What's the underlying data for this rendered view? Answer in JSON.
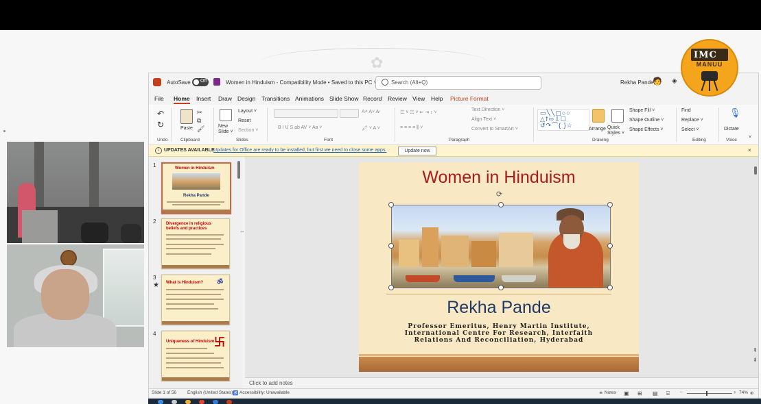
{
  "window": {
    "autosave_label": "AutoSave",
    "autosave_state": "Off",
    "doc_title": "Women in Hinduism  -  Compatibility Mode • Saved to this PC ˅",
    "search_placeholder": "Search (Alt+Q)",
    "user_name": "Rekha Pande"
  },
  "menu": [
    "File",
    "Home",
    "Insert",
    "Draw",
    "Design",
    "Transitions",
    "Animations",
    "Slide Show",
    "Record",
    "Review",
    "View",
    "Help",
    "Picture Format"
  ],
  "ribbon": {
    "undo": "Undo",
    "clipboard": "Clipboard",
    "paste": "Paste",
    "slides": "Slides",
    "new_slide": "New Slide ˅",
    "layout": "Layout ˅",
    "reset": "Reset",
    "section": "Section ˅",
    "font": "Font",
    "paragraph": "Paragraph",
    "text_direction": "Text Direction ˅",
    "align_text": "Align Text ˅",
    "convert_smartart": "Convert to SmartArt ˅",
    "drawing": "Drawing",
    "arrange": "Arrange",
    "quick_styles": "Quick Styles ˅",
    "shape_fill": "Shape Fill ˅",
    "shape_outline": "Shape Outline ˅",
    "shape_effects": "Shape Effects ˅",
    "find": "Find",
    "replace": "Replace ˅",
    "select": "Select ˅",
    "editing": "Editing",
    "dictate": "Dictate",
    "voice": "Voice",
    "font_bar": "B  I  U  S  ab  AV ˅  Aa ˅"
  },
  "updates": {
    "label": "UPDATES AVAILABLE",
    "message": "Updates for Office are ready to be installed, but first we need to close some apps.",
    "button": "Update now"
  },
  "thumbnails": [
    {
      "num": "1",
      "title": "Women in Hinduism",
      "sub": "Rekha Pande"
    },
    {
      "num": "2",
      "title": "Divergence in religious beliefs and practices",
      "sub": ""
    },
    {
      "num": "3",
      "title": "What is Hinduism?",
      "sub": ""
    },
    {
      "num": "4",
      "title": "Uniqueness of Hinduism",
      "sub": ""
    }
  ],
  "slide": {
    "title": "Women in Hinduism",
    "name": "Rekha Pande",
    "subtitle": "Professor Emeritus, Henry Martin Institute, International Centre For Research, Interfaith Relations And Reconciliation, Hyderabad"
  },
  "notes_placeholder": "Click to add notes",
  "status": {
    "slide_count": "Slide 1 of 56",
    "language": "English (United States)",
    "accessibility": "Accessibility: Unavailable",
    "notes": "Notes",
    "zoom": "74%"
  },
  "logo": {
    "letters": "IMC",
    "sub": "MANUU"
  },
  "colors": {
    "accent": "#c43e1c",
    "slide_title": "#a81b1b",
    "slide_name": "#1f3a68",
    "logo": "#f4a51c"
  }
}
